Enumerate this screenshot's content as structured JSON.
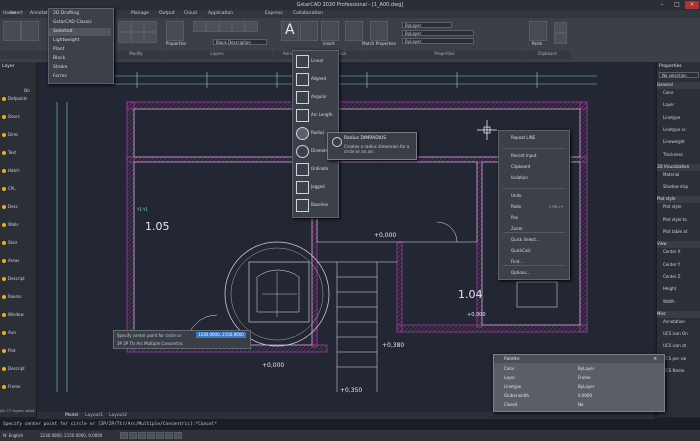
{
  "window": {
    "title": "GstarCAD 2020 Professional - [1_A00.dwg]",
    "min_icon": "minimize-icon",
    "max_icon": "maximize-icon",
    "close_icon": "close-icon"
  },
  "ribbon_tabs": [
    "Home",
    "Insert",
    "Annotate",
    "View",
    "Manage",
    "Output",
    "Cloud",
    "Application",
    "Express",
    "Collaboration"
  ],
  "workspace_menu": {
    "current": "2D Drafting",
    "items": [
      "2D Drafting",
      "GstarCAD Classic",
      "Selected",
      "Lightweight",
      "Plant",
      "Block",
      "Stroke",
      "Forms"
    ]
  },
  "ribbon": {
    "groups": [
      "Draw",
      "Modify",
      "Annotation",
      "Layers",
      "Block",
      "Properties",
      "Clipboard"
    ],
    "layer_value": "Black Description",
    "color_value": "ByLayer",
    "linetype_value": "ByLayer",
    "lineweight_value": "ByLayer",
    "buttons": [
      "Properties",
      "Insert",
      "Match Properties",
      "Paste"
    ]
  },
  "dimension_menu": {
    "items": [
      "Linear",
      "Aligned",
      "Angular",
      "Arc Length",
      "Radius",
      "Diameter",
      "Ordinate",
      "Jogged",
      "Baseline"
    ],
    "tooltip": {
      "title": "Radius DIMRADIUS",
      "body": "Creates a radius dimension for a circle or an arc"
    }
  },
  "context_menu": {
    "items": [
      "Repeat LINE",
      "Recent Input",
      "Clipboard",
      "Isolation",
      "Undo",
      "Redo",
      "Pan",
      "Zoom",
      "Quick Select...",
      "QuickCalc",
      "Find...",
      "Options..."
    ],
    "shortcuts": {
      "Redo": "CTRL+Y"
    }
  },
  "left_panel": {
    "header": "Layer",
    "on_label": "On",
    "rows": [
      "Defpoints",
      "Doors",
      "Dims",
      "Text",
      "Hatch",
      "CPL",
      "Desc",
      "Walls",
      "Stair",
      "Areas",
      "Descript",
      "Rooms",
      "Window",
      "Axis",
      "Plot",
      "Descript",
      "Frame"
    ],
    "footer": "All: 17 layers; total 17 l"
  },
  "right_panel": {
    "header": "Properties",
    "no_selection": "No selection",
    "sections": [
      "General",
      "3D Visualization",
      "Plot style",
      "View",
      "Misc"
    ],
    "rows": [
      "Color",
      "Layer",
      "Linetype",
      "Linetype sc",
      "Lineweight",
      "Thickness",
      "Material",
      "Shadow disp",
      "Plot style",
      "Plot style ta",
      "Plot table at",
      "Center X",
      "Center Y",
      "Center Z",
      "Height",
      "Width",
      "Annotation",
      "UCS icon On",
      "UCS icon at",
      "UCS per vie",
      "UCS Name"
    ]
  },
  "drawing": {
    "labels": [
      "1.05",
      "1.04",
      "+0,000",
      "+0,000",
      "+0,350",
      "+0,000",
      "+0,380",
      "Y1-Y1",
      "Y1-Y1"
    ]
  },
  "command_input": {
    "prompt": "Specify center point for circle or",
    "coords": "1230.0000, 2150.0000",
    "options": "3P  2P  Ttr  Arc  Multiple  Concentric"
  },
  "command_line": "Specify center point for circle or [3P/2P/Ttr/Arc/Multiple/Concentric]:*Cancel*",
  "model_tabs": [
    "Model",
    "Layout1",
    "Layout2"
  ],
  "properties_palette": {
    "title": "Palette",
    "rows": [
      {
        "label": "Color",
        "value": "ByLayer"
      },
      {
        "label": "Layer",
        "value": "Frame"
      },
      {
        "label": "Linetype",
        "value": "ByLayer"
      },
      {
        "label": "Global width",
        "value": "0.0000"
      },
      {
        "label": "Closed",
        "value": "No"
      }
    ]
  },
  "status_bar": {
    "coords": "1230.0000, 2150.0000, 0.0000",
    "units": "N: English"
  },
  "colors": {
    "canvas": "#232733",
    "wall": "#a03aa0",
    "line": "#e8e8ee",
    "dim": "#7fd0d0",
    "accent": "#3a78c8"
  }
}
